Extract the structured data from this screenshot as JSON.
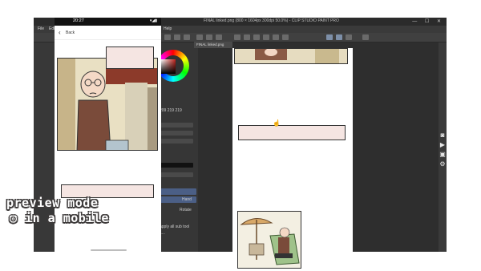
{
  "window": {
    "title": "FINAL linked.png (800 × 1604px 300dpi 50.0%) - CLIP STUDIO PAINT PRO",
    "controls": "— ☐ ✕",
    "menus": [
      "File",
      "Edit",
      "Help"
    ],
    "canvas_tab": "FINAL linked.png"
  },
  "tool_panel": {
    "size_value": "209 219 219",
    "hand_label": "Hand",
    "rotate_label": "Rotate",
    "apply_label": "apply all sub tool",
    "lock_label": "L..."
  },
  "phone": {
    "status_time": "20:27",
    "status_right": "▾◢▮",
    "back_label": "Back",
    "caption_lines": [
      "preview mode",
      "in a mobile"
    ]
  },
  "colors": {
    "app_bg": "#323232",
    "text_box_fill": "#f5e5e2",
    "caption_outline": "#3d3a3a"
  },
  "icons": {
    "back": "chevron-left-icon",
    "cursor": "hand-cursor-icon",
    "right_panel": [
      "camera-icon",
      "video-icon",
      "image-icon",
      "gear-icon"
    ]
  }
}
